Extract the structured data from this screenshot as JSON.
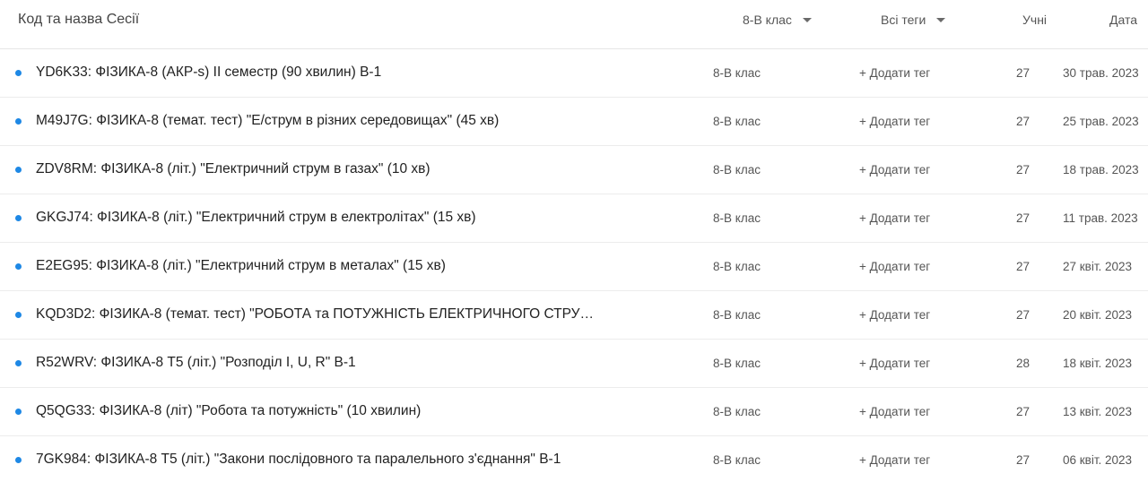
{
  "header": {
    "title": "Код та назва Сесії",
    "class_filter": "8-В клас",
    "tags_filter": "Всі теги",
    "students": "Учні",
    "date": "Дата"
  },
  "rows": [
    {
      "name": "YD6K33: ФІЗИКА-8 (АКР-s) ІІ семестр (90 хвилин) В-1",
      "class": "8-В клас",
      "add_tag": "+ Додати тег",
      "students": "27",
      "date": "30 трав. 2023"
    },
    {
      "name": "M49J7G: ФІЗИКА-8 (темат. тест) \"Е/струм в різних середовищах\" (45 хв)",
      "class": "8-В клас",
      "add_tag": "+ Додати тег",
      "students": "27",
      "date": "25 трав. 2023"
    },
    {
      "name": "ZDV8RM: ФІЗИКА-8 (літ.) \"Електричний струм в газах\" (10 хв)",
      "class": "8-В клас",
      "add_tag": "+ Додати тег",
      "students": "27",
      "date": "18 трав. 2023"
    },
    {
      "name": "GKGJ74: ФІЗИКА-8 (літ.) \"Електричний струм в електролітах\" (15 хв)",
      "class": "8-В клас",
      "add_tag": "+ Додати тег",
      "students": "27",
      "date": "11 трав. 2023"
    },
    {
      "name": "E2EG95: ФІЗИКА-8 (літ.) \"Електричний струм в металах\" (15 хв)",
      "class": "8-В клас",
      "add_tag": "+ Додати тег",
      "students": "27",
      "date": "27 квіт. 2023"
    },
    {
      "name": "KQD3D2: ФІЗИКА-8 (темат. тест) \"РОБОТА та ПОТУЖНІСТЬ ЕЛЕКТРИЧНОГО СТРУМУ\"...",
      "class": "8-В клас",
      "add_tag": "+ Додати тег",
      "students": "27",
      "date": "20 квіт. 2023"
    },
    {
      "name": "R52WRV: ФІЗИКА-8 Т5 (літ.) \"Розподіл I, U, R\" В-1",
      "class": "8-В клас",
      "add_tag": "+ Додати тег",
      "students": "28",
      "date": "18 квіт. 2023"
    },
    {
      "name": "Q5QG33: ФІЗИКА-8 (літ) \"Робота та потужність\" (10 хвилин)",
      "class": "8-В клас",
      "add_tag": "+ Додати тег",
      "students": "27",
      "date": "13 квіт. 2023"
    },
    {
      "name": "7GK984: ФІЗИКА-8 Т5 (літ.) \"Закони послідовного та паралельного з'єднання\" В-1",
      "class": "8-В клас",
      "add_tag": "+ Додати тег",
      "students": "27",
      "date": "06 квіт. 2023"
    }
  ],
  "colors": {
    "dot": "#1e88e5",
    "divider": "#ececec"
  }
}
